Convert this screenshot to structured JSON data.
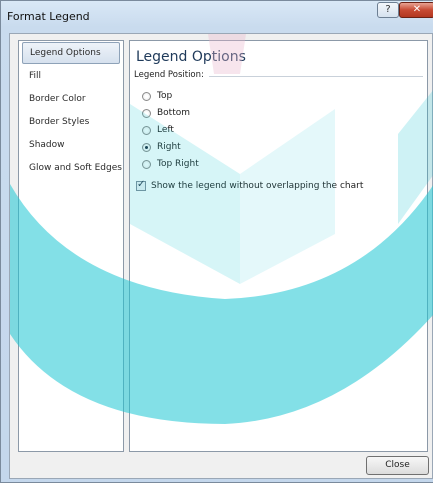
{
  "window": {
    "title": "Format Legend",
    "help_glyph": "?",
    "close_glyph": "✕"
  },
  "sidebar": {
    "items": [
      {
        "label": "Legend Options",
        "selected": true
      },
      {
        "label": "Fill"
      },
      {
        "label": "Border Color"
      },
      {
        "label": "Border Styles"
      },
      {
        "label": "Shadow"
      },
      {
        "label": "Glow and Soft Edges"
      }
    ]
  },
  "panel": {
    "title": "Legend Options",
    "section_label": "Legend Position:",
    "positions": [
      {
        "label": "Top",
        "checked": false
      },
      {
        "label": "Bottom",
        "checked": false
      },
      {
        "label": "Left",
        "checked": false
      },
      {
        "label": "Right",
        "checked": true
      },
      {
        "label": "Top Right",
        "checked": false
      }
    ],
    "overlap_checkbox": {
      "label": "Show the legend without overlapping the chart",
      "checked": true,
      "tick": "✓"
    }
  },
  "footer": {
    "close_label": "Close"
  },
  "colors": {
    "watermark": "#1ec6d3",
    "watermark_pink": "#e8b4cc"
  }
}
